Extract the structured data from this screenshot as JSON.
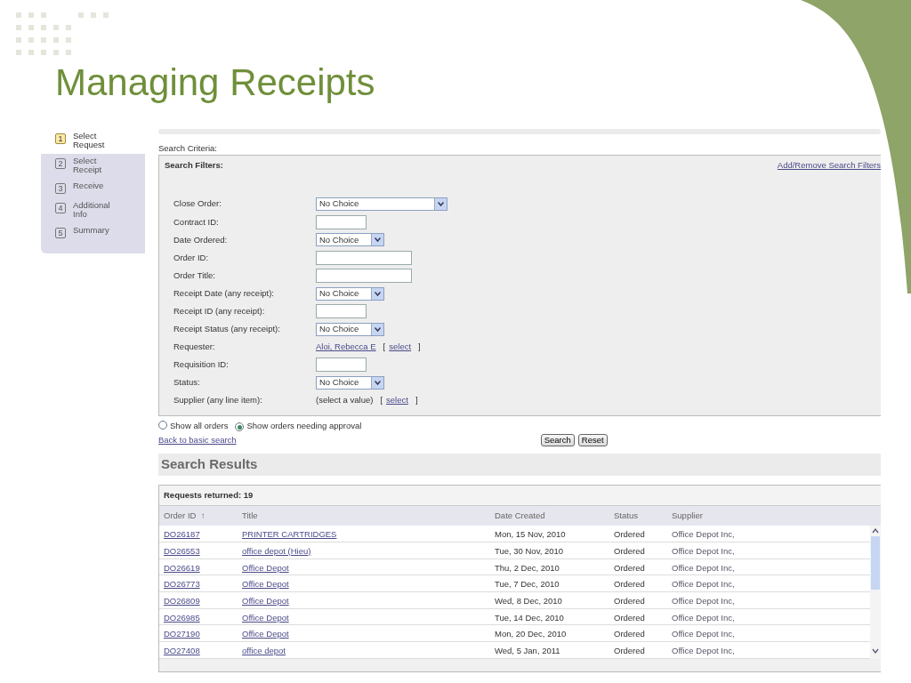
{
  "slide_title": "Managing Receipts",
  "steps": [
    {
      "number": "1",
      "label": "Select Request",
      "selected": true
    },
    {
      "number": "2",
      "label": "Select Receipt",
      "selected": false
    },
    {
      "number": "3",
      "label": "Receive",
      "selected": false
    },
    {
      "number": "4",
      "label": "Additional Info",
      "selected": false
    },
    {
      "number": "5",
      "label": "Summary",
      "selected": false
    }
  ],
  "search_criteria_label": "Search Criteria:",
  "filters_heading": "Search Filters:",
  "add_remove_link": "Add/Remove Search Filters",
  "filters": [
    {
      "label": "Close Order:",
      "kind": "select",
      "wide": true,
      "value": "No Choice"
    },
    {
      "label": "Contract ID:",
      "kind": "text",
      "wide": false
    },
    {
      "label": "Date Ordered:",
      "kind": "select",
      "wide": false,
      "value": "No Choice"
    },
    {
      "label": "Order ID:",
      "kind": "text",
      "wide": true
    },
    {
      "label": "Order Title:",
      "kind": "text",
      "wide": true
    },
    {
      "label": "Receipt Date (any receipt):",
      "kind": "select",
      "wide": false,
      "value": "No Choice"
    },
    {
      "label": "Receipt ID (any receipt):",
      "kind": "text",
      "wide": false
    },
    {
      "label": "Receipt Status (any receipt):",
      "kind": "select",
      "wide": false,
      "value": "No Choice"
    },
    {
      "label": "Requester:",
      "kind": "picker",
      "value": "Aloi, Rebecca E",
      "open_bracket": "[",
      "link": "select",
      "close_bracket": "]"
    },
    {
      "label": "Requisition ID:",
      "kind": "text",
      "wide": false
    },
    {
      "label": "Status:",
      "kind": "select",
      "wide": false,
      "value": "No Choice"
    },
    {
      "label": "Supplier (any line item):",
      "kind": "picker",
      "placeholder": "(select a value)",
      "open_bracket": "[",
      "link": "select",
      "close_bracket": "]"
    }
  ],
  "show_options": [
    {
      "label": "Show all orders",
      "selected": false
    },
    {
      "label": "Show orders needing approval",
      "selected": true
    }
  ],
  "back_link": "Back to basic search",
  "buttons": [
    "Search",
    "Reset"
  ],
  "results_heading": "Search Results",
  "results_count": "Requests returned: 19",
  "table": {
    "columns": [
      {
        "label": "Order ID",
        "sort": "↑"
      },
      {
        "label": "Title"
      },
      {
        "label": "Date Created"
      },
      {
        "label": "Status"
      },
      {
        "label": "Supplier"
      }
    ],
    "rows": [
      [
        "DO26187",
        "PRINTER CARTRIDGES",
        "Mon, 15 Nov, 2010",
        "Ordered",
        "Office Depot Inc,"
      ],
      [
        "DO26553",
        "office depot (Hieu)",
        "Tue, 30 Nov, 2010",
        "Ordered",
        "Office Depot Inc,"
      ],
      [
        "DO26619",
        "Office Depot",
        "Thu, 2 Dec, 2010",
        "Ordered",
        "Office Depot Inc,"
      ],
      [
        "DO26773",
        "Office Depot",
        "Tue, 7 Dec, 2010",
        "Ordered",
        "Office Depot Inc,"
      ],
      [
        "DO26809",
        "Office Depot",
        "Wed, 8 Dec, 2010",
        "Ordered",
        "Office Depot Inc,"
      ],
      [
        "DO26985",
        "Office Depot",
        "Tue, 14 Dec, 2010",
        "Ordered",
        "Office Depot Inc,"
      ],
      [
        "DO27190",
        "Office Depot",
        "Mon, 20 Dec, 2010",
        "Ordered",
        "Office Depot Inc,"
      ],
      [
        "DO27408",
        "office depot",
        "Wed, 5 Jan, 2011",
        "Ordered",
        "Office Depot Inc,"
      ]
    ]
  }
}
